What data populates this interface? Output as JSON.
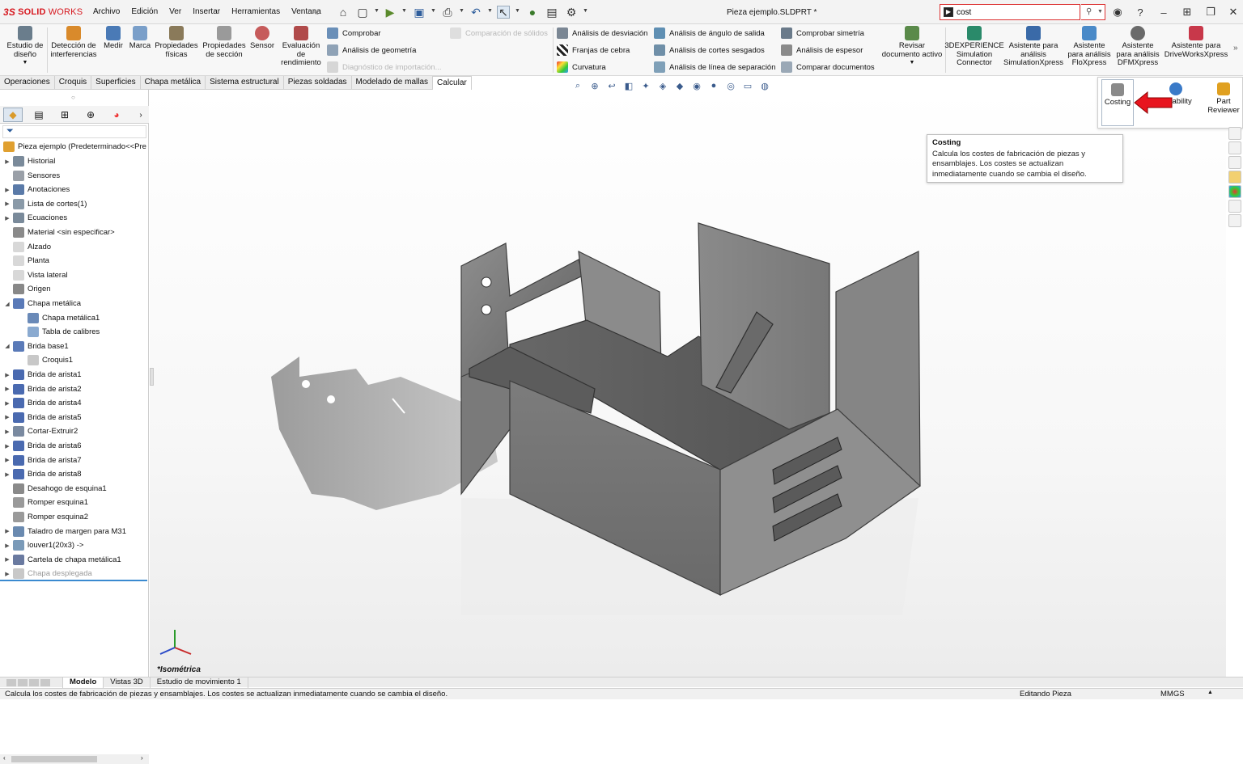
{
  "app": {
    "logo_ds": "3S",
    "logo_solid": "SOLID",
    "logo_works": "WORKS",
    "document_title": "Pieza ejemplo.SLDPRT *"
  },
  "menus": [
    "Archivo",
    "Edición",
    "Ver",
    "Insertar",
    "Herramientas",
    "Ventana"
  ],
  "search": {
    "value": "cost"
  },
  "ribbon": {
    "estudio": "Estudio de\ndiseño",
    "deteccion": "Detección de\ninterferencias",
    "medir": "Medir",
    "marca": "Marca",
    "propfis": "Propiedades\nfísicas",
    "propsec": "Propiedades\nde sección",
    "sensor": "Sensor",
    "evaluacion": "Evaluación\nde\nrendimiento",
    "comprobar": "Comprobar",
    "analgeo": "Análisis de geometría",
    "diagnostico": "Diagnóstico de importación...",
    "comparacion": "Comparación de sólidos",
    "desviacion": "Análisis de desviación",
    "cebra": "Franjas de cebra",
    "curvatura": "Curvatura",
    "angulo": "Análisis de ángulo de salida",
    "cortes": "Análisis de cortes sesgados",
    "separacion": "Análisis de línea de separación",
    "simetria": "Comprobar simetría",
    "espesor": "Análisis de espesor",
    "compdoc": "Comparar documentos",
    "revisar": "Revisar\ndocumento activo",
    "sim3dx": "3DEXPERIENCE\nSimulation\nConnector",
    "asimxpress": "Asistente para\nanálisis\nSimulationXpress",
    "aflo": "Asistente\npara análisis\nFloXpress",
    "adfm": "Asistente\npara análisis\nDFMXpress",
    "adrive": "Asistente para\nDriveWorksXpress"
  },
  "tabs": [
    "Operaciones",
    "Croquis",
    "Superficies",
    "Chapa metálica",
    "Sistema estructural",
    "Piezas soldadas",
    "Modelado de mallas",
    "Calcular"
  ],
  "flyout": {
    "costing": "Costing",
    "sustainability": "nability",
    "reviewer": "Part\nReviewer"
  },
  "tooltip": {
    "title": "Costing",
    "body": "Calcula los costes de fabricación de piezas y ensamblajes. Los costes se actualizan inmediatamente cuando se cambia el diseño."
  },
  "tree": {
    "root": "Pieza ejemplo  (Predeterminado<<Pre",
    "items": [
      "Historial",
      "Sensores",
      "Anotaciones",
      "Lista de cortes(1)",
      "Ecuaciones",
      "Material <sin especificar>",
      "Alzado",
      "Planta",
      "Vista lateral",
      "Origen",
      "Chapa metálica",
      "Chapa metálica1",
      "Tabla de calibres",
      "Brida base1",
      "Croquis1",
      "Brida de arista1",
      "Brida de arista2",
      "Brida de arista4",
      "Brida de arista5",
      "Cortar-Extruir2",
      "Brida de arista6",
      "Brida de arista7",
      "Brida de arista8",
      "Desahogo de esquina1",
      "Romper esquina1",
      "Romper esquina2",
      "Taladro de margen para M31",
      "louver1(20x3) ->",
      "Cartela de chapa metálica1",
      "Chapa desplegada"
    ]
  },
  "view": {
    "label": "*Isométrica"
  },
  "bottom_tabs": [
    "Modelo",
    "Vistas 3D",
    "Estudio de movimiento 1"
  ],
  "status": {
    "message": "Calcula los costes de fabricación de piezas y ensamblajes. Los costes se actualizan inmediatamente cuando se cambia el diseño.",
    "mode": "Editando Pieza",
    "units": "MMGS"
  }
}
